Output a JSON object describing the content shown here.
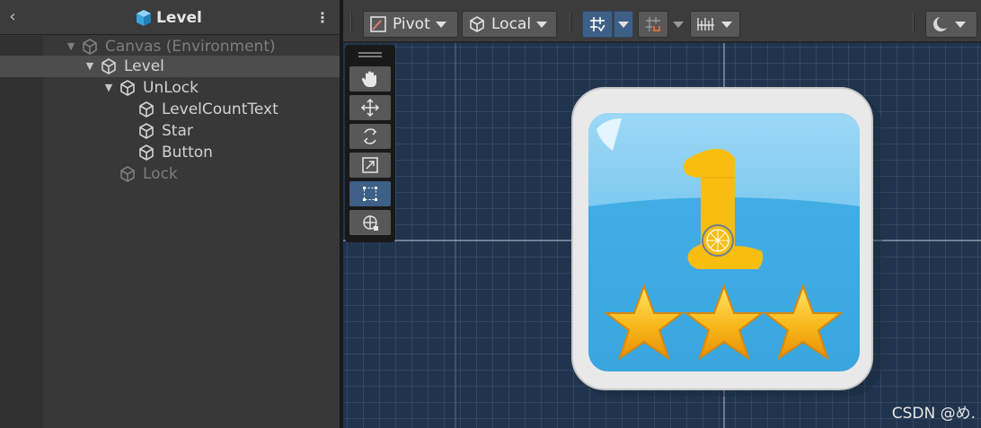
{
  "hierarchy": {
    "title": "Level",
    "back_icon": "chevron-left-icon",
    "menu_icon": "kebab-menu-icon",
    "items": [
      {
        "label": "Canvas (Environment)",
        "expanded": true,
        "depth": 0,
        "disabled": true
      },
      {
        "label": "Level",
        "expanded": true,
        "depth": 1,
        "selected": true
      },
      {
        "label": "UnLock",
        "expanded": true,
        "depth": 2
      },
      {
        "label": "LevelCountText",
        "depth": 3
      },
      {
        "label": "Star",
        "depth": 3
      },
      {
        "label": "Button",
        "depth": 3
      },
      {
        "label": "Lock",
        "depth": 2,
        "disabled": true
      }
    ]
  },
  "toolbar": {
    "pivot_label": "Pivot",
    "local_label": "Local"
  },
  "scene": {
    "level_number": "1",
    "star_count": 3,
    "tools": [
      "hand-tool",
      "move-tool",
      "rotate-tool",
      "scale-tool",
      "rect-tool",
      "transform-tool"
    ],
    "active_tool": "rect-tool"
  },
  "watermark": "CSDN @め.",
  "colors": {
    "accent": "#3e5f86",
    "button_frame": "#e8e8e8",
    "button_blue": "#4ab4e8",
    "number_yellow": "#f7bd0f",
    "star_gold": "#f5b416"
  }
}
